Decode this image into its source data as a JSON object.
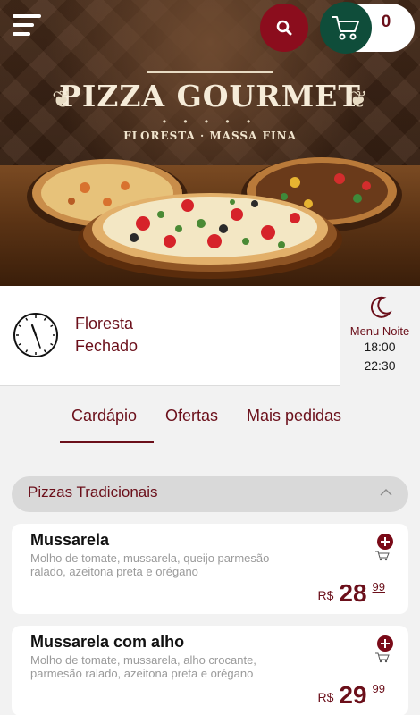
{
  "header": {
    "menu_icon": "hamburger-menu-icon",
    "search_icon": "search-icon",
    "cart_icon": "shopping-cart-icon",
    "cart_count": "0"
  },
  "hero": {
    "title": "PIZZA GOURMET",
    "dots": "• • • • •",
    "subtitle": "FLORESTA · MASSA FINA"
  },
  "status": {
    "clock_icon": "clock-icon",
    "location": "Floresta",
    "open_state": "Fechado",
    "night_menu": {
      "icon": "moon-icon",
      "label": "Menu Noite",
      "open_time": "18:00",
      "close_time": "22:30"
    }
  },
  "tabs": [
    {
      "label": "Cardápio",
      "active": true
    },
    {
      "label": "Ofertas",
      "active": false
    },
    {
      "label": "Mais pedidas",
      "active": false
    }
  ],
  "category": {
    "label": "Pizzas Tradicionais",
    "expanded": true
  },
  "items": [
    {
      "name": "Mussarela",
      "description": "Molho de tomate, mussarela, queijo parmesão ralado, azeitona preta e orégano",
      "currency": "R$",
      "price_int": "28",
      "price_cents": "99"
    },
    {
      "name": "Mussarela com alho",
      "description": "Molho de tomate, mussarela, alho crocante, parmesão ralado, azeitona preta e orégano",
      "currency": "R$",
      "price_int": "29",
      "price_cents": "99"
    }
  ],
  "colors": {
    "brand": "#6b0f1a",
    "search_button": "#8b0d1d",
    "cart_button": "#0f4d3a",
    "background": "#f2f2f2"
  }
}
